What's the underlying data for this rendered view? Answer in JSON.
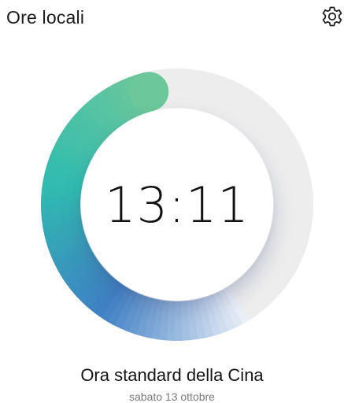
{
  "header": {
    "title": "Ore locali"
  },
  "icons": {
    "settings": "gear-icon"
  },
  "clock": {
    "time": "13:11",
    "progress_fraction": 0.55,
    "colors": {
      "track": "#ededed",
      "gradient_start": "#e9eef7",
      "gradient_mid_blue": "#3f80c4",
      "gradient_mid_teal": "#2fbcb0",
      "gradient_end": "#6cc79a"
    }
  },
  "timezone": {
    "name": "Ora standard della Cina",
    "date": "sabato 13 ottobre"
  }
}
